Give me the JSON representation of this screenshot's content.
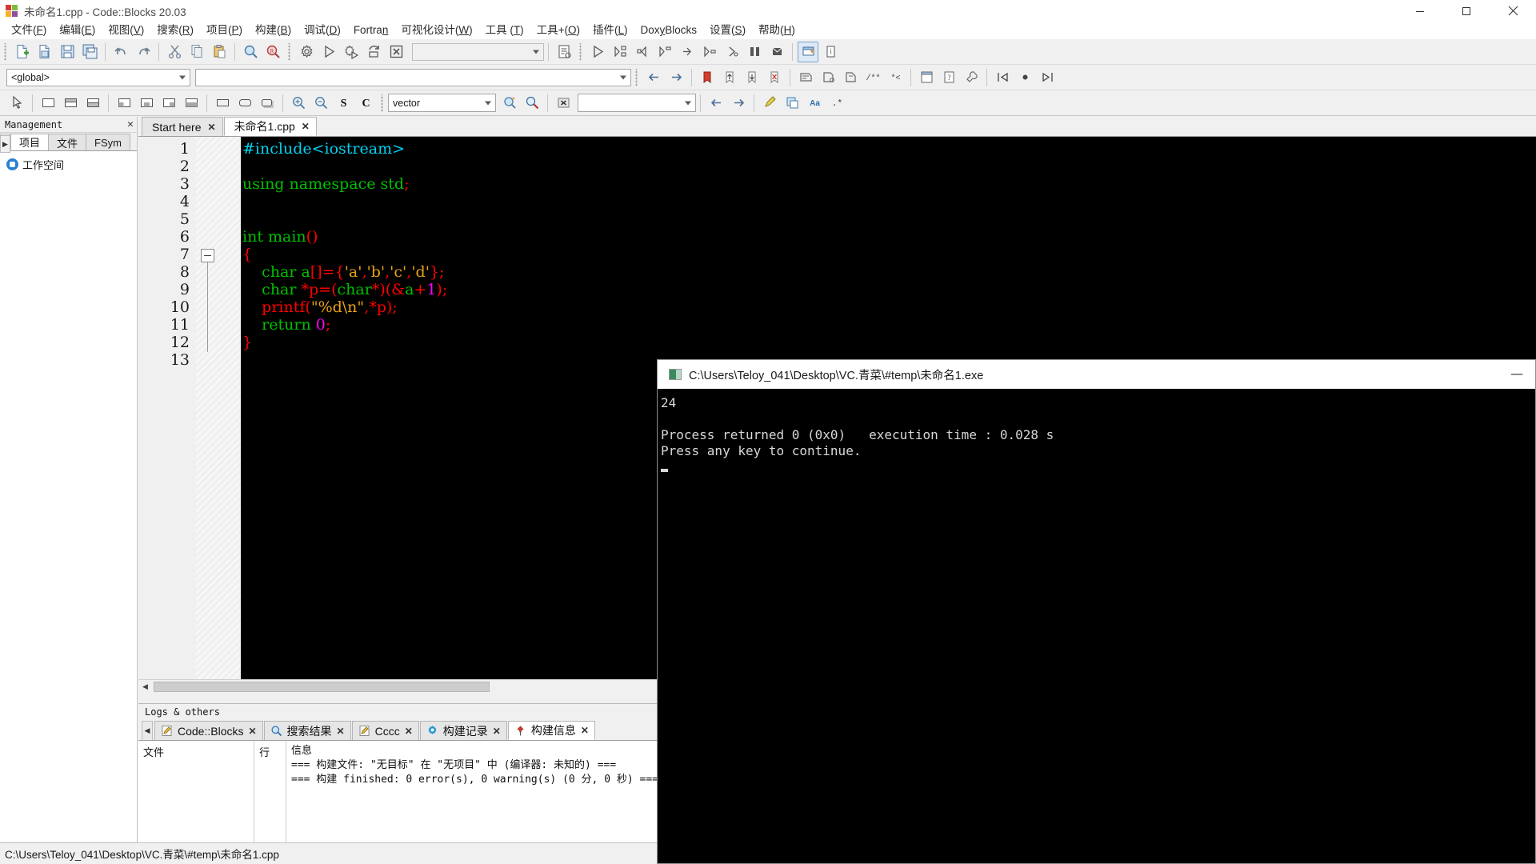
{
  "window": {
    "title": "未命名1.cpp - Code::Blocks 20.03",
    "app_icon": "codeblocks-logo-icon",
    "minimize_label": "—",
    "maximize_label": "▢",
    "close_label": "✕"
  },
  "menubar": {
    "items": [
      {
        "label": "文件(F)",
        "mnemonic": "F"
      },
      {
        "label": "编辑(E)",
        "mnemonic": "E"
      },
      {
        "label": "视图(V)",
        "mnemonic": "V"
      },
      {
        "label": "搜索(R)",
        "mnemonic": "R"
      },
      {
        "label": "项目(P)",
        "mnemonic": "P"
      },
      {
        "label": "构建(B)",
        "mnemonic": "B"
      },
      {
        "label": "调试(D)",
        "mnemonic": "D"
      },
      {
        "label": "Fortran",
        "mnemonic": "n"
      },
      {
        "label": "可视化设计(W)",
        "mnemonic": "W"
      },
      {
        "label": "工具 (T)",
        "mnemonic": "T"
      },
      {
        "label": "工具+(O)",
        "mnemonic": "O"
      },
      {
        "label": "插件(L)",
        "mnemonic": "L"
      },
      {
        "label": "DoxyBlocks",
        "mnemonic": "y"
      },
      {
        "label": "设置(S)",
        "mnemonic": "S"
      },
      {
        "label": "帮助(H)",
        "mnemonic": "H"
      }
    ]
  },
  "toolbar_main": {
    "icons": [
      "new-file-icon",
      "open-file-icon",
      "save-icon",
      "save-all-icon",
      "undo-icon",
      "redo-icon",
      "cut-icon",
      "copy-icon",
      "paste-icon",
      "find-icon",
      "replace-icon"
    ],
    "build_icons": [
      "build-icon",
      "run-icon",
      "build-and-run-icon",
      "rebuild-icon",
      "abort-icon"
    ],
    "build_target_value": "",
    "build_target_placeholder": ""
  },
  "toolbar_debug": {
    "scope_value": "<global>",
    "function_value": "",
    "icons": [
      "debug-continue-icon",
      "debug-run-to-cursor-icon",
      "debug-next-line-icon",
      "debug-step-into-icon",
      "debug-step-out-icon",
      "debug-next-instruction-icon",
      "debug-step-into-instruction-icon",
      "debug-break-icon",
      "debug-stop-icon",
      "debugging-windows-icon",
      "various-info-icon"
    ],
    "nav_icons": [
      "back-icon",
      "forward-icon"
    ],
    "bookmark_icons": [
      "toggle-bookmark-icon",
      "prev-bookmark-icon",
      "next-bookmark-icon",
      "clear-bookmarks-icon"
    ],
    "doxy_icons": [
      "doxyblocks-comment-icon",
      "doxyblocks-block-icon",
      "doxyblocks-tag-icon",
      "doxyblocks-run-icon",
      "doxyblocks-extract-icon",
      "doxyblocks-config-icon"
    ],
    "jump_icons": [
      "jump-back-icon",
      "jump-home-icon",
      "jump-forward-icon"
    ]
  },
  "toolbar_wx": {
    "icons": [
      "pointer-icon",
      "panel-icon",
      "sizer-h-icon",
      "sizer-grid-icon",
      "align-left-icon",
      "align-center-icon",
      "align-right-icon",
      "align-justify-icon",
      "box-icon",
      "box-round-icon",
      "box-shadow-icon",
      "zoom-in-icon",
      "zoom-out-icon",
      "symbol-s-icon",
      "symbol-c-icon"
    ],
    "search_value": "vector",
    "search_icons": [
      "search-doc-icon",
      "search-find-icon",
      "search-clear-icon"
    ],
    "secondary_value": "",
    "nav_icons": [
      "prev-icon",
      "next-icon"
    ],
    "extra_icons": [
      "highlight-icon",
      "translate-icon",
      "match-case-icon",
      "regex-icon"
    ]
  },
  "management": {
    "title": "Management",
    "close_icon": "close-icon",
    "tab_nav_prev": "◀",
    "tab_nav_next": "▶",
    "tabs": [
      {
        "label": "项目",
        "active": true
      },
      {
        "label": "文件",
        "active": false
      },
      {
        "label": "FSym",
        "active": false
      }
    ],
    "tree": [
      {
        "label": "工作空间",
        "icon": "workspace-icon"
      }
    ]
  },
  "editor": {
    "tabs": [
      {
        "label": "Start here",
        "active": false,
        "close_icon": "close-icon"
      },
      {
        "label": "未命名1.cpp",
        "active": true,
        "close_icon": "close-icon"
      }
    ],
    "line_numbers": [
      "1",
      "2",
      "3",
      "4",
      "5",
      "6",
      "7",
      "8",
      "9",
      "10",
      "11",
      "12",
      "13"
    ],
    "lines": [
      [
        {
          "t": "#include",
          "c": "pre"
        },
        {
          "t": "<iostream>",
          "c": "pre"
        }
      ],
      [],
      [
        {
          "t": "using",
          "c": "kw"
        },
        {
          "t": " ",
          "c": "txt"
        },
        {
          "t": "namespace",
          "c": "kw"
        },
        {
          "t": " ",
          "c": "txt"
        },
        {
          "t": "std",
          "c": "kw"
        },
        {
          "t": ";",
          "c": "op"
        }
      ],
      [],
      [],
      [
        {
          "t": "int",
          "c": "kw"
        },
        {
          "t": " ",
          "c": "txt"
        },
        {
          "t": "main",
          "c": "id"
        },
        {
          "t": "()",
          "c": "op"
        }
      ],
      [
        {
          "t": "{",
          "c": "op"
        }
      ],
      [
        {
          "t": "    ",
          "c": "txt"
        },
        {
          "t": "char",
          "c": "kw"
        },
        {
          "t": " ",
          "c": "txt"
        },
        {
          "t": "a",
          "c": "id"
        },
        {
          "t": "[]={",
          "c": "op"
        },
        {
          "t": "'a'",
          "c": "str"
        },
        {
          "t": ",",
          "c": "op"
        },
        {
          "t": "'b'",
          "c": "str"
        },
        {
          "t": ",",
          "c": "op"
        },
        {
          "t": "'c'",
          "c": "str"
        },
        {
          "t": ",",
          "c": "op"
        },
        {
          "t": "'d'",
          "c": "str"
        },
        {
          "t": "};",
          "c": "op"
        }
      ],
      [
        {
          "t": "    ",
          "c": "txt"
        },
        {
          "t": "char",
          "c": "kw"
        },
        {
          "t": " ",
          "c": "txt"
        },
        {
          "t": "*p=(",
          "c": "op"
        },
        {
          "t": "char",
          "c": "kw"
        },
        {
          "t": "*)(&",
          "c": "op"
        },
        {
          "t": "a",
          "c": "id"
        },
        {
          "t": "+",
          "c": "op"
        },
        {
          "t": "1",
          "c": "num"
        },
        {
          "t": ");",
          "c": "op"
        }
      ],
      [
        {
          "t": "    ",
          "c": "txt"
        },
        {
          "t": "printf",
          "c": "fn"
        },
        {
          "t": "(",
          "c": "op"
        },
        {
          "t": "\"%d\\n\"",
          "c": "str"
        },
        {
          "t": ",*p);",
          "c": "op"
        }
      ],
      [
        {
          "t": "    ",
          "c": "txt"
        },
        {
          "t": "return",
          "c": "kw"
        },
        {
          "t": " ",
          "c": "txt"
        },
        {
          "t": "0",
          "c": "num"
        },
        {
          "t": ";",
          "c": "op"
        }
      ],
      [
        {
          "t": "}",
          "c": "op"
        }
      ],
      []
    ]
  },
  "logs": {
    "panel_title": "Logs & others",
    "tab_nav_prev": "◀",
    "tabs": [
      {
        "label": "Code::Blocks",
        "icon": "pencil-icon",
        "active": false
      },
      {
        "label": "搜索结果",
        "icon": "search-icon",
        "active": false
      },
      {
        "label": "Cccc",
        "icon": "pencil-icon",
        "active": false
      },
      {
        "label": "构建记录",
        "icon": "gear-icon",
        "active": false
      },
      {
        "label": "构建信息",
        "icon": "pin-icon",
        "active": true
      }
    ],
    "columns": [
      "文件",
      "行",
      "信息"
    ],
    "rows": [
      {
        "file": "",
        "line": "",
        "message": "=== 构建文件: \"无目标\" 在 \"无项目\" 中 (编译器: 未知的) ==="
      },
      {
        "file": "",
        "line": "",
        "message": "=== 构建 finished: 0 error(s), 0 warning(s) (0 分, 0 秒) ==="
      }
    ]
  },
  "statusbar": {
    "path": "C:\\Users\\Teloy_041\\Desktop\\VC.青菜\\#temp\\未命名1.cpp"
  },
  "console": {
    "title": "C:\\Users\\Teloy_041\\Desktop\\VC.青菜\\#temp\\未命名1.exe",
    "icon": "console-window-icon",
    "minimize_label": "—",
    "output_lines": [
      "24",
      "",
      "Process returned 0 (0x0)   execution time : 0.028 s",
      "Press any key to continue."
    ]
  },
  "colors": {
    "titlebar_bg": "#ffffff",
    "toolbar_bg": "#f0f0f0",
    "editor_bg": "#000000",
    "console_bg": "#000000",
    "accent": "#2a7fd4",
    "keyword": "#00c000",
    "preprocessor": "#00d2f0",
    "string": "#e8a317",
    "operator": "#ff0000",
    "number": "#ff00ff"
  }
}
